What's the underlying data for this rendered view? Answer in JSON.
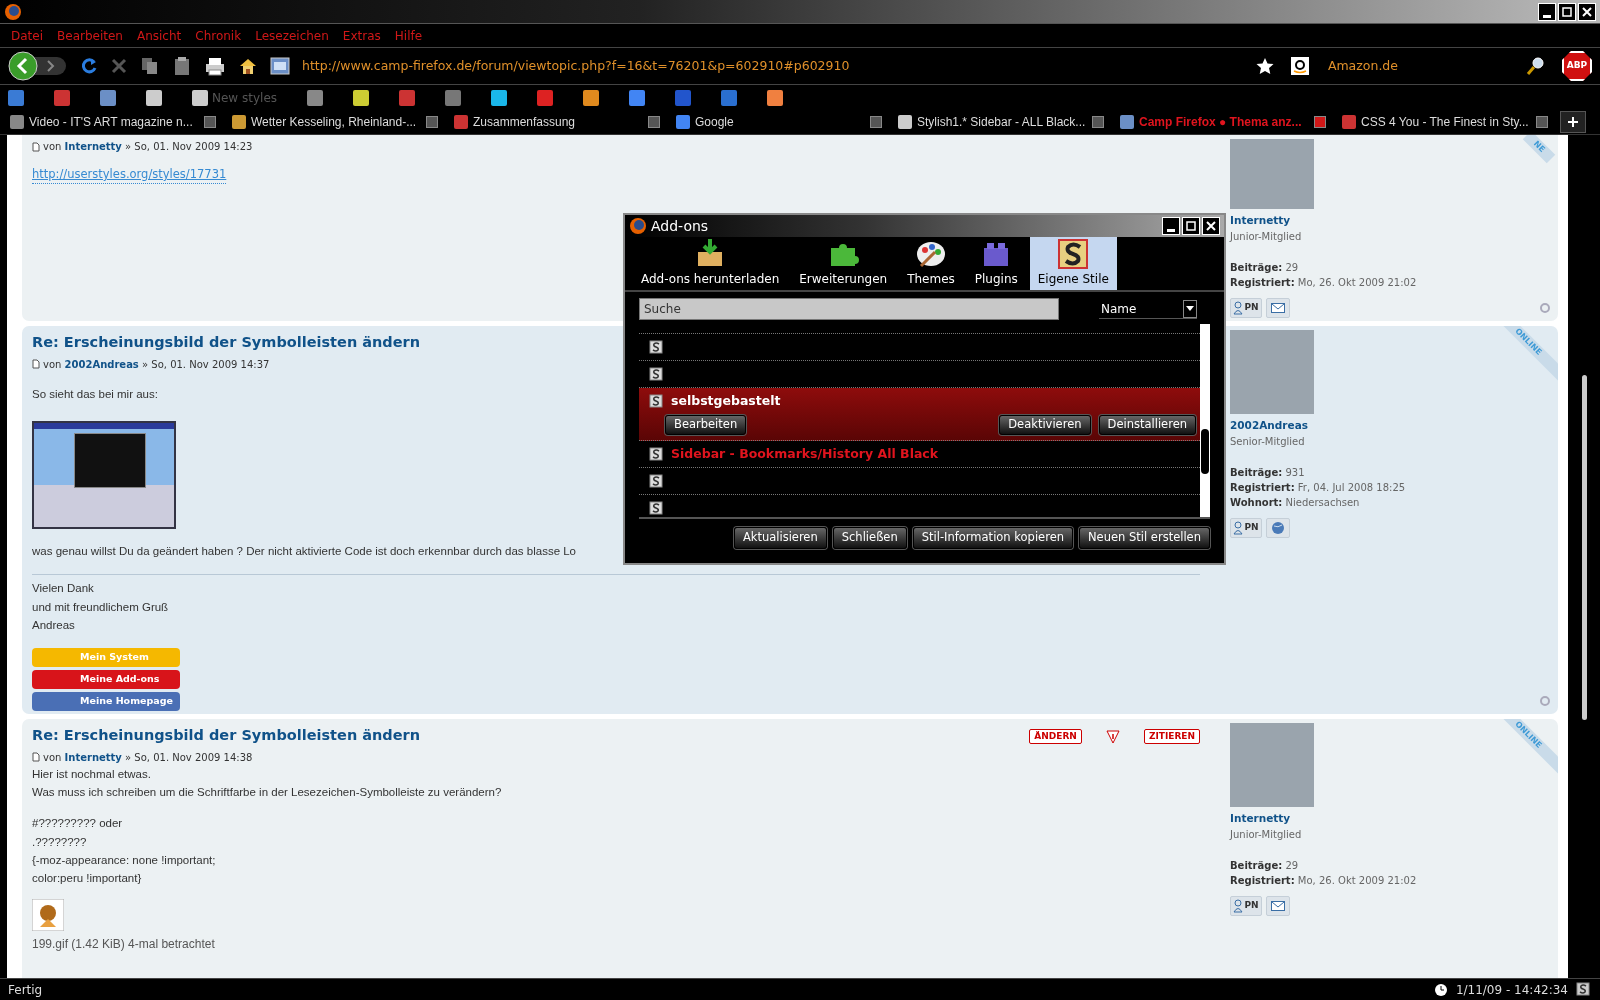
{
  "menu": [
    "Datei",
    "Bearbeiten",
    "Ansicht",
    "Chronik",
    "Lesezeichen",
    "Extras",
    "Hilfe"
  ],
  "navigation": {
    "url": "http://www.camp-firefox.de/forum/viewtopic.php?f=16&t=76201&p=602910#p602910",
    "search_engine": "Amazon.de",
    "adblock_label": "ABP"
  },
  "bookmarks": [
    {
      "label": "New styles"
    }
  ],
  "tabs": [
    {
      "label": "Video - IT'S ART magazine n...",
      "selected": false
    },
    {
      "label": "Wetter Kesseling, Rheinland-...",
      "selected": false
    },
    {
      "label": "Zusammenfassung",
      "selected": false
    },
    {
      "label": "Google",
      "selected": false
    },
    {
      "label": "Stylish1.* Sidebar - ALL Black...",
      "selected": false
    },
    {
      "label": "Camp Firefox ● Thema anz...",
      "selected": true
    },
    {
      "label": "CSS 4 You - The Finest in Sty...",
      "selected": false
    }
  ],
  "posts": [
    {
      "by": "von",
      "author": "Internetty",
      "date": "» So, 01. Nov 2009 14:23",
      "blocks": [
        {
          "kind": "link",
          "text": "http://userstyles.org/styles/17731"
        }
      ],
      "profile": {
        "name": "Internetty",
        "rank": "Junior-Mitglied",
        "online": "NE",
        "fields": [
          {
            "label": "Beiträge:",
            "value": "29"
          },
          {
            "label": "Registriert:",
            "value": "Mo, 26. Okt 2009 21:02"
          }
        ],
        "buttons": [
          {
            "kind": "pm",
            "label": "PN"
          },
          {
            "kind": "mail"
          }
        ]
      }
    },
    {
      "title": "Re: Erscheinungsbild der Symbolleisten ändern",
      "by": "von",
      "author": "2002Andreas",
      "date": "» So, 01. Nov 2009 14:37",
      "blocks": [
        {
          "kind": "text",
          "text": "So sieht das bei mir aus:"
        },
        {
          "kind": "image"
        },
        {
          "kind": "text",
          "text": "was genau willst Du da geändert haben ? Der nicht aktivierte Code ist doch erkennbar durch das blasse Lo"
        },
        {
          "kind": "signature",
          "lines": [
            "Vielen Dank",
            "und mit freundlichem Gruß",
            "Andreas"
          ]
        },
        {
          "kind": "banners",
          "items": [
            {
              "label": "Mein System",
              "color": "#f5b800"
            },
            {
              "label": "Meine Add-ons",
              "color": "#d8141a"
            },
            {
              "label": "Meine Homepage",
              "color": "#4a6fb5"
            }
          ]
        }
      ],
      "profile": {
        "name": "2002Andreas",
        "rank": "Senior-Mitglied",
        "online": "ONLINE",
        "fields": [
          {
            "label": "Beiträge:",
            "value": "931"
          },
          {
            "label": "Registriert:",
            "value": "Fr, 04. Jul 2008 18:25"
          },
          {
            "label": "Wohnort:",
            "value": "Niedersachsen"
          }
        ],
        "buttons": [
          {
            "kind": "pm",
            "label": "PN"
          },
          {
            "kind": "web"
          }
        ]
      }
    },
    {
      "title": "Re: Erscheinungsbild der Symbolleisten ändern",
      "by": "von",
      "author": "Internetty",
      "date": "» So, 01. Nov 2009 14:38",
      "actions": [
        "ÄNDERN",
        "ZITIEREN"
      ],
      "blocks": [
        {
          "kind": "text",
          "text": "Hier ist nochmal etwas."
        },
        {
          "kind": "text",
          "text": "Was muss ich schreiben um die Schriftfarbe in der Lesezeichen-Symbolleiste zu verändern?"
        },
        {
          "kind": "gap"
        },
        {
          "kind": "text",
          "text": "#????????? oder"
        },
        {
          "kind": "text",
          "text": ".????????"
        },
        {
          "kind": "text",
          "text": "{-moz-appearance: none !important;"
        },
        {
          "kind": "text",
          "text": "color:peru !important}"
        },
        {
          "kind": "attachment",
          "text": "199.gif (1.42 KiB) 4-mal betrachtet"
        }
      ],
      "profile": {
        "name": "Internetty",
        "rank": "Junior-Mitglied",
        "online": "ONLINE",
        "fields": [
          {
            "label": "Beiträge:",
            "value": "29"
          },
          {
            "label": "Registriert:",
            "value": "Mo, 26. Okt 2009 21:02"
          }
        ],
        "buttons": [
          {
            "kind": "pm",
            "label": "PN"
          },
          {
            "kind": "mail"
          }
        ]
      }
    }
  ],
  "dialog": {
    "title": "Add-ons",
    "tabs": [
      {
        "label": "Add-ons herunterladen",
        "kind": "download",
        "selected": false
      },
      {
        "label": "Erweiterungen",
        "kind": "puzzle",
        "selected": false
      },
      {
        "label": "Themes",
        "kind": "palette",
        "selected": false
      },
      {
        "label": "Plugins",
        "kind": "brick",
        "selected": false
      },
      {
        "label": "Eigene Stile",
        "kind": "style",
        "selected": true
      }
    ],
    "search": {
      "placeholder": "Suche"
    },
    "sort": "Name",
    "items": [
      {
        "selected": false
      },
      {
        "selected": false
      },
      {
        "name": "selbstgebastelt",
        "color": "#ffffff",
        "selected": true,
        "buttons": [
          "Bearbeiten",
          "Deaktivieren",
          "Deinstallieren"
        ]
      },
      {
        "name": "Sidebar - Bookmarks/History All Black",
        "color": "#e0141e",
        "selected": false
      },
      {
        "selected": false
      },
      {
        "selected": false
      }
    ],
    "buttons": [
      "Aktualisieren",
      "Schließen",
      "Stil-Information kopieren",
      "Neuen Stil erstellen"
    ]
  },
  "status_bar": {
    "text": "Fertig",
    "clock": "1/11/09 - 14:42:34"
  }
}
